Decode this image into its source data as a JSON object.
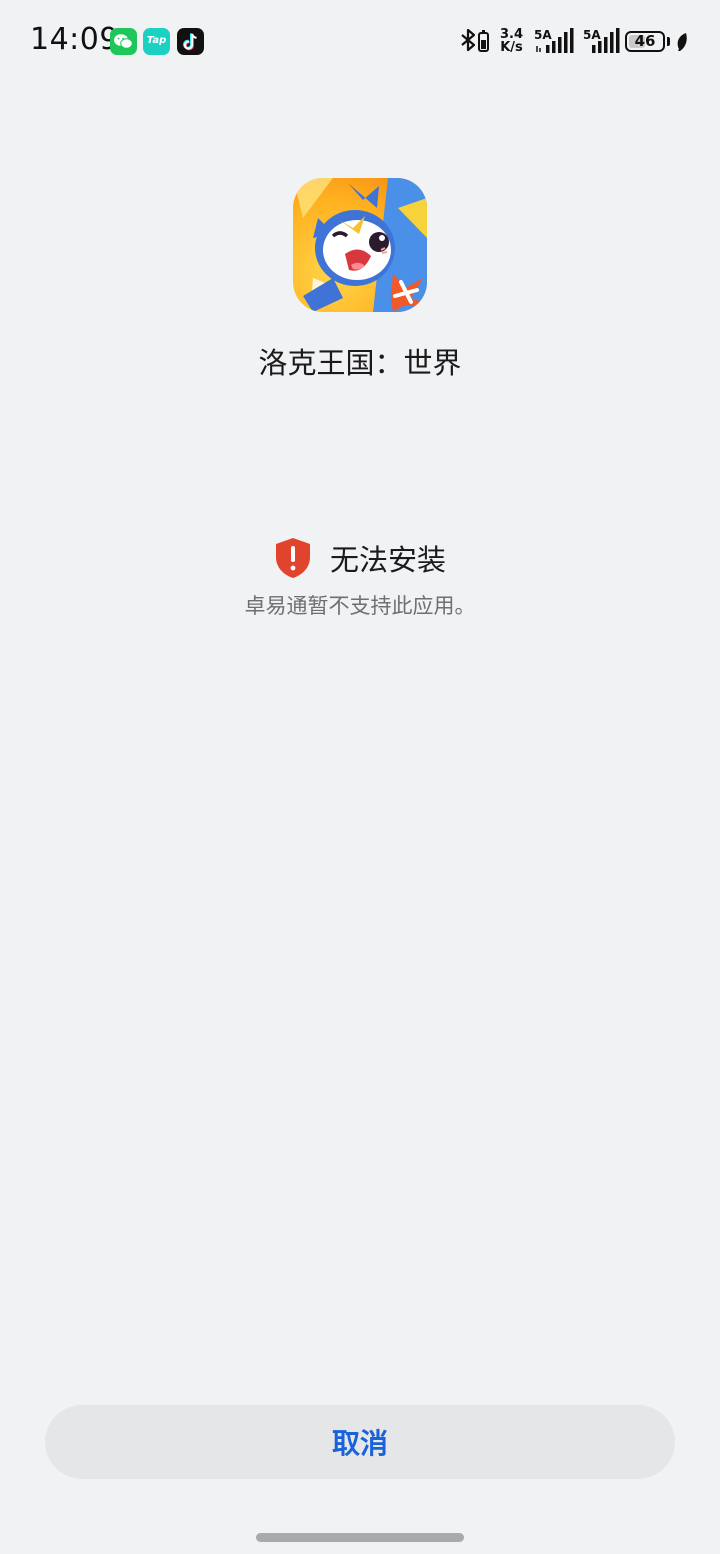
{
  "status_bar": {
    "time": "14:09",
    "notification_icons": [
      "wechat-icon",
      "tap-icon",
      "tiktok-icon"
    ],
    "tap_label": "Tap",
    "net_speed_value": "3.4",
    "net_speed_unit": "K/s",
    "signal_1_label": "5A",
    "signal_2_label": "5A",
    "battery_level": "46"
  },
  "app": {
    "name": "洛克王国：世界"
  },
  "install_status": {
    "title": "无法安装",
    "message": "卓易通暂不支持此应用。",
    "colors": {
      "shield": "#e2432d"
    }
  },
  "actions": {
    "cancel_label": "取消",
    "colors": {
      "text": "#1a62d9",
      "background": "#e5e6e8"
    }
  }
}
